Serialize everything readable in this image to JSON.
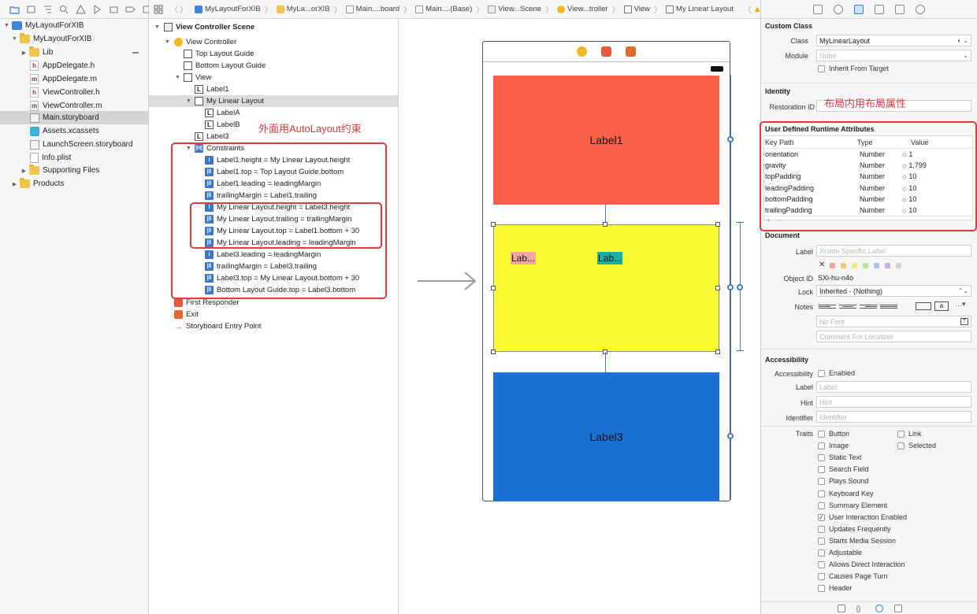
{
  "jumpbar": {
    "items": [
      "MyLayoutForXIB",
      "MyLa...orXIB",
      "Main....board",
      "Main....(Base)",
      "View...Scene",
      "View...troller",
      "View",
      "My Linear Layout"
    ]
  },
  "navigator": {
    "project": "MyLayoutForXIB",
    "group": "MyLayoutForXIB",
    "files": {
      "lib": "Lib",
      "appdelegate_h": "AppDelegate.h",
      "appdelegate_m": "AppDelegate.m",
      "viewcontroller_h": "ViewController.h",
      "viewcontroller_m": "ViewController.m",
      "main_storyboard": "Main.storyboard",
      "assets": "Assets.xcassets",
      "launchscreen": "LaunchScreen.storyboard",
      "info_plist": "Info.plist",
      "supporting": "Supporting Files",
      "products": "Products"
    }
  },
  "outline": {
    "scene": "View Controller Scene",
    "view_controller": "View Controller",
    "top_guide": "Top Layout Guide",
    "bottom_guide": "Bottom Layout Guide",
    "view": "View",
    "label1": "Label1",
    "linear": "My Linear Layout",
    "labelA": "LabelA",
    "labelB": "LabelB",
    "label3": "Label3",
    "constraints": "Constraints",
    "constraint_items": [
      "Label1.height = My Linear Layout.height",
      "Label1.top = Top Layout Guide.bottom",
      "Label1.leading = leadingMargin",
      "trailingMargin = Label1.trailing",
      "My Linear Layout.height = Label3.height",
      "My Linear Layout.trailing = trailingMargin",
      "My Linear Layout.top = Label1.bottom + 30",
      "My Linear Layout.leading = leadingMargin",
      "Label3.leading = leadingMargin",
      "trailingMargin = Label3.trailing",
      "Label3.top = My Linear Layout.bottom + 30",
      "Bottom Layout Guide.top = Label3.bottom"
    ],
    "first_responder": "First Responder",
    "exit": "Exit",
    "entry_point": "Storyboard Entry Point",
    "annotation": "外面用AutoLayout约束"
  },
  "canvas": {
    "label1": "Label1",
    "labelA": "Lab...",
    "labelB": "Lab...",
    "label3": "Label3"
  },
  "inspector": {
    "custom_class": {
      "title": "Custom Class",
      "class_label": "Class",
      "class_value": "MyLinearLayout",
      "module_label": "Module",
      "module_placeholder": "None",
      "inherit_label": "Inherit From Target"
    },
    "identity": {
      "title": "Identity",
      "restoration_label": "Restoration ID",
      "annotation": "布局内用布局属性"
    },
    "udra": {
      "title": "User Defined Runtime Attributes",
      "headers": [
        "Key Path",
        "Type",
        "Value"
      ],
      "rows": [
        {
          "key": "orientation",
          "type": "Number",
          "value": "1"
        },
        {
          "key": "gravity",
          "type": "Number",
          "value": "1,799"
        },
        {
          "key": "topPadding",
          "type": "Number",
          "value": "10"
        },
        {
          "key": "leadingPadding",
          "type": "Number",
          "value": "10"
        },
        {
          "key": "bottomPadding",
          "type": "Number",
          "value": "10"
        },
        {
          "key": "trailingPadding",
          "type": "Number",
          "value": "10"
        }
      ],
      "add": "+",
      "remove": "−"
    },
    "document": {
      "title": "Document",
      "label_label": "Label",
      "label_placeholder": "Xcode Specific Label",
      "object_id_label": "Object ID",
      "object_id_value": "SXi-hu-n4o",
      "lock_label": "Lock",
      "lock_value": "Inherited - (Nothing)",
      "notes_label": "Notes",
      "font_placeholder": "No Font",
      "comment_placeholder": "Comment For Localizer"
    },
    "accessibility": {
      "title": "Accessibility",
      "accessibility_label": "Accessibility",
      "enabled_label": "Enabled",
      "label_label": "Label",
      "label_placeholder": "Label",
      "hint_label": "Hint",
      "hint_placeholder": "Hint",
      "identifier_label": "Identifier",
      "identifier_placeholder": "Identifier",
      "traits_label": "Traits",
      "traits_left": [
        {
          "label": "Button",
          "checked": false
        },
        {
          "label": "Image",
          "checked": false
        },
        {
          "label": "Static Text",
          "checked": false
        },
        {
          "label": "Search Field",
          "checked": false
        },
        {
          "label": "Plays Sound",
          "checked": false
        },
        {
          "label": "Keyboard Key",
          "checked": false
        },
        {
          "label": "Summary Element",
          "checked": false
        },
        {
          "label": "User Interaction Enabled",
          "checked": true
        },
        {
          "label": "Updates Frequently",
          "checked": false
        },
        {
          "label": "Starts Media Session",
          "checked": false
        },
        {
          "label": "Adjustable",
          "checked": false
        },
        {
          "label": "Allows Direct Interaction",
          "checked": false
        },
        {
          "label": "Causes Page Turn",
          "checked": false
        },
        {
          "label": "Header",
          "checked": false
        }
      ],
      "traits_right": [
        {
          "label": "Link",
          "checked": false
        },
        {
          "label": "Selected",
          "checked": false
        }
      ]
    }
  },
  "colors": {
    "label1": "#fb5f4a",
    "linear": "#fcfb31",
    "labelA": "#f5a6a3",
    "labelB": "#1ab1a3",
    "label3": "#1871d3",
    "annotation": "#e23b3b",
    "constraint_icon": "#3d77c8"
  }
}
